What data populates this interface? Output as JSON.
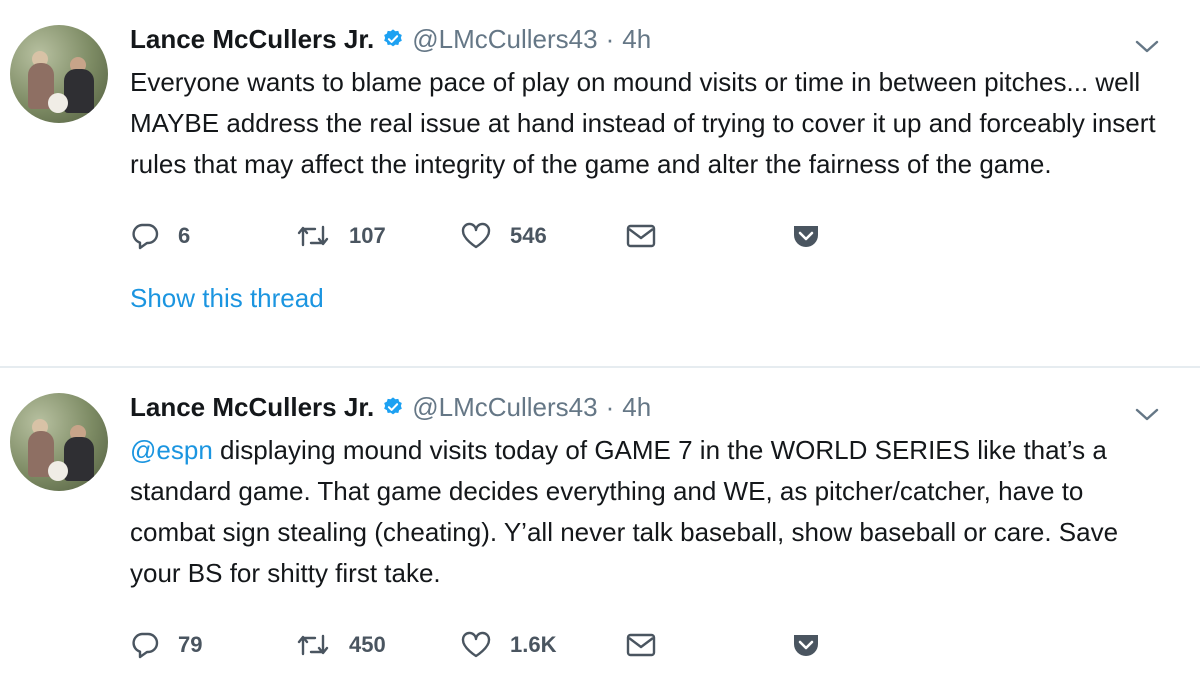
{
  "tweets": [
    {
      "author_name": "Lance McCullers Jr.",
      "handle": "@LMcCullers43",
      "separator": "·",
      "time": "4h",
      "mention": "",
      "text": "Everyone wants to blame pace of play on mound visits or time in between pitches... well MAYBE address the real issue at hand instead of trying to cover it up and forceably insert rules that may affect the integrity of the game and alter the fairness of the game.",
      "replies": "6",
      "retweets": "107",
      "likes": "546",
      "show_thread": "Show this thread"
    },
    {
      "author_name": "Lance McCullers Jr.",
      "handle": "@LMcCullers43",
      "separator": "·",
      "time": "4h",
      "mention": "@espn",
      "text": " displaying mound visits today of GAME 7 in the WORLD SERIES like that’s a standard game. That game decides everything and WE, as pitcher/catcher, have to combat sign stealing (cheating). Y’all never talk baseball, show baseball or care. Save your BS for shitty first take.",
      "replies": "79",
      "retweets": "450",
      "likes": "1.6K"
    }
  ],
  "icons": {
    "reply": "reply-icon",
    "retweet": "retweet-icon",
    "like": "heart-icon",
    "dm": "envelope-icon",
    "save": "pocket-icon",
    "verified": "verified-badge-icon",
    "menu": "chevron-down-icon"
  },
  "colors": {
    "link": "#1b95e0",
    "verified": "#1da1f2",
    "muted": "#657786",
    "text": "#14171a",
    "pocket": "#4a5560"
  }
}
